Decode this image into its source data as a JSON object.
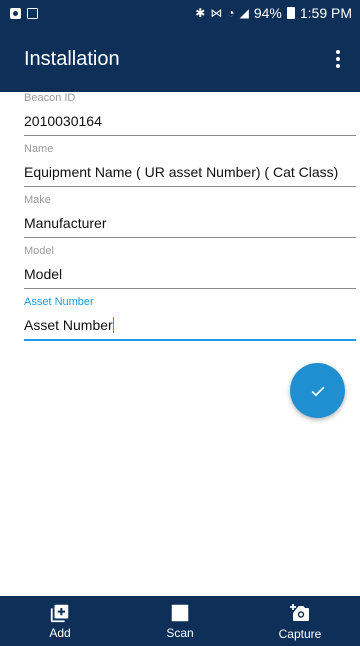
{
  "status_bar": {
    "battery": "94%",
    "time": "1:59 PM"
  },
  "app_bar": {
    "title": "Installation"
  },
  "form": {
    "fields": [
      {
        "label": "Beacon ID",
        "value": "2010030164"
      },
      {
        "label": "Name",
        "value": "Equipment Name ( UR asset Number) ( Cat Class)"
      },
      {
        "label": "Make",
        "value": "Manufacturer"
      },
      {
        "label": "Model",
        "value": "Model"
      },
      {
        "label": "Asset Number",
        "value": "Asset Number"
      }
    ]
  },
  "bottom_nav": {
    "items": [
      {
        "label": "Add",
        "icon": "add-box-icon"
      },
      {
        "label": "Scan",
        "icon": "square-icon"
      },
      {
        "label": "Capture",
        "icon": "add-camera-icon"
      }
    ]
  },
  "colors": {
    "primary": "#0d2f58",
    "accent": "#1a9be6",
    "fab": "#1f8fd1"
  }
}
